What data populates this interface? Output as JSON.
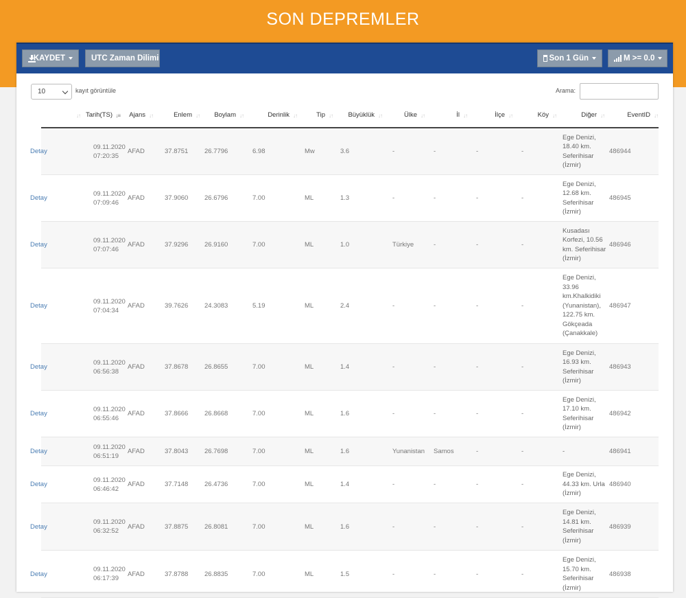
{
  "page": {
    "title": "SON DEPREMLER"
  },
  "toolbar": {
    "save_label": "KAYDET",
    "timezone_label": "UTC Zaman Dilimi",
    "period_label": "Son 1 Gün",
    "magnitude_label": "M >= 0.0"
  },
  "controls": {
    "page_length_value": "10",
    "page_length_label": "kayıt görüntüle",
    "search_label": "Arama:",
    "search_value": ""
  },
  "colors": {
    "header_band": "#f39a23",
    "toolbar": "#1e4b94",
    "button": "#8c9bab",
    "link": "#4a7db3"
  },
  "table": {
    "sorted_column": "Tarih(TS)",
    "columns": [
      "",
      "Tarih(TS)",
      "Ajans",
      "Enlem",
      "Boylam",
      "Derinlik",
      "Tip",
      "Büyüklük",
      "Ülke",
      "İl",
      "İlçe",
      "Köy",
      "Diğer",
      "EventID"
    ],
    "rows": [
      {
        "detay": "Detay",
        "tarih": "09.11.2020 07:20:35",
        "ajans": "AFAD",
        "enlem": "37.8751",
        "boylam": "26.7796",
        "derinlik": "6.98",
        "tip": "Mw",
        "buyukluk": "3.6",
        "ulke": "-",
        "il": "-",
        "ilce": "-",
        "koy": "-",
        "diger": "Ege Denizi, 18.40 km. Seferihisar (İzmir)",
        "eventid": "486944"
      },
      {
        "detay": "Detay",
        "tarih": "09.11.2020 07:09:46",
        "ajans": "AFAD",
        "enlem": "37.9060",
        "boylam": "26.6796",
        "derinlik": "7.00",
        "tip": "ML",
        "buyukluk": "1.3",
        "ulke": "-",
        "il": "-",
        "ilce": "-",
        "koy": "-",
        "diger": "Ege Denizi, 12.68 km. Seferihisar (İzmir)",
        "eventid": "486945"
      },
      {
        "detay": "Detay",
        "tarih": "09.11.2020 07:07:46",
        "ajans": "AFAD",
        "enlem": "37.9296",
        "boylam": "26.9160",
        "derinlik": "7.00",
        "tip": "ML",
        "buyukluk": "1.0",
        "ulke": "Türkiye",
        "il": "-",
        "ilce": "-",
        "koy": "-",
        "diger": "Kusadası Korfezi, 10.56 km. Seferihisar (İzmir)",
        "eventid": "486946"
      },
      {
        "detay": "Detay",
        "tarih": "09.11.2020 07:04:34",
        "ajans": "AFAD",
        "enlem": "39.7626",
        "boylam": "24.3083",
        "derinlik": "5.19",
        "tip": "ML",
        "buyukluk": "2.4",
        "ulke": "-",
        "il": "-",
        "ilce": "-",
        "koy": "-",
        "diger": "Ege Denizi, 33.96 km.Khalkidiki (Yunanistan), 122.75 km. Gökçeada (Çanakkale)",
        "eventid": "486947"
      },
      {
        "detay": "Detay",
        "tarih": "09.11.2020 06:56:38",
        "ajans": "AFAD",
        "enlem": "37.8678",
        "boylam": "26.8655",
        "derinlik": "7.00",
        "tip": "ML",
        "buyukluk": "1.4",
        "ulke": "-",
        "il": "-",
        "ilce": "-",
        "koy": "-",
        "diger": "Ege Denizi, 16.93 km. Seferihisar (İzmir)",
        "eventid": "486943"
      },
      {
        "detay": "Detay",
        "tarih": "09.11.2020 06:55:46",
        "ajans": "AFAD",
        "enlem": "37.8666",
        "boylam": "26.8668",
        "derinlik": "7.00",
        "tip": "ML",
        "buyukluk": "1.6",
        "ulke": "-",
        "il": "-",
        "ilce": "-",
        "koy": "-",
        "diger": "Ege Denizi, 17.10 km. Seferihisar (İzmir)",
        "eventid": "486942"
      },
      {
        "detay": "Detay",
        "tarih": "09.11.2020 06:51:19",
        "ajans": "AFAD",
        "enlem": "37.8043",
        "boylam": "26.7698",
        "derinlik": "7.00",
        "tip": "ML",
        "buyukluk": "1.6",
        "ulke": "Yunanistan",
        "il": "Samos",
        "ilce": "-",
        "koy": "-",
        "diger": "-",
        "eventid": "486941"
      },
      {
        "detay": "Detay",
        "tarih": "09.11.2020 06:46:42",
        "ajans": "AFAD",
        "enlem": "37.7148",
        "boylam": "26.4736",
        "derinlik": "7.00",
        "tip": "ML",
        "buyukluk": "1.4",
        "ulke": "-",
        "il": "-",
        "ilce": "-",
        "koy": "-",
        "diger": "Ege Denizi, 44.33 km. Urla (İzmir)",
        "eventid": "486940"
      },
      {
        "detay": "Detay",
        "tarih": "09.11.2020 06:32:52",
        "ajans": "AFAD",
        "enlem": "37.8875",
        "boylam": "26.8081",
        "derinlik": "7.00",
        "tip": "ML",
        "buyukluk": "1.6",
        "ulke": "-",
        "il": "-",
        "ilce": "-",
        "koy": "-",
        "diger": "Ege Denizi, 14.81 km. Seferihisar (İzmir)",
        "eventid": "486939"
      },
      {
        "detay": "Detay",
        "tarih": "09.11.2020 06:17:39",
        "ajans": "AFAD",
        "enlem": "37.8788",
        "boylam": "26.8835",
        "derinlik": "7.00",
        "tip": "ML",
        "buyukluk": "1.5",
        "ulke": "-",
        "il": "-",
        "ilce": "-",
        "koy": "-",
        "diger": "Ege Denizi, 15.70 km. Seferihisar (İzmir)",
        "eventid": "486938"
      }
    ]
  }
}
